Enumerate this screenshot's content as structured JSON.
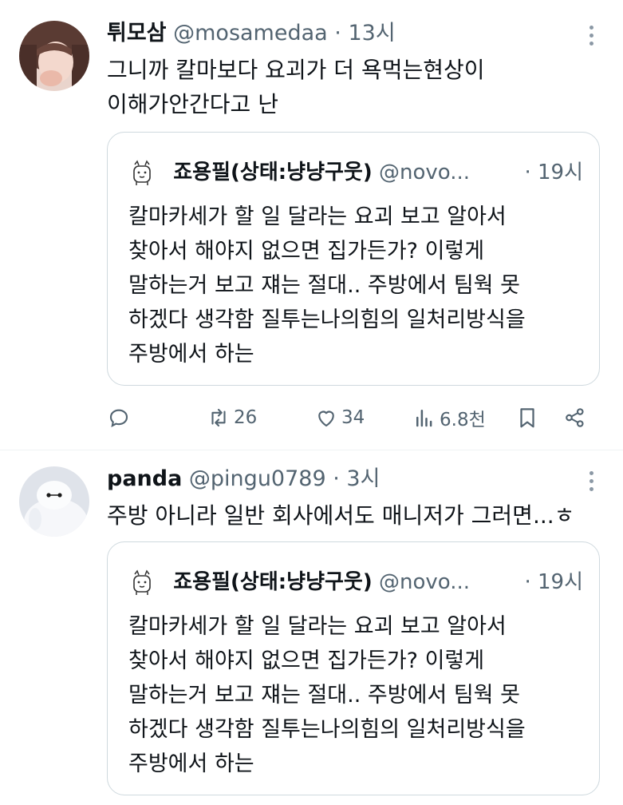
{
  "tweets": [
    {
      "name": "튀모삼",
      "handle": "@mosamedaa",
      "dot": "·",
      "time": "13시",
      "text": "그니까 칼마보다 요괴가 더 욕먹는현상이\n이해가안간다고 난",
      "quote": {
        "name": "죠용필(상태:냥냥구웃)",
        "handle": "@novo...",
        "time": "· 19시",
        "text": "칼마카세가 할 일 달라는 요괴 보고 알아서\n찾아서 해야지 없으면 집가든가? 이렇게\n말하는거 보고 쟤는 절대.. 주방에서 팀웍 못\n하겠다 생각함 질투는나의힘의 일처리방식을\n주방에서 하는"
      },
      "stats": {
        "retweets": "26",
        "likes": "34",
        "views": "6.8천"
      }
    },
    {
      "name": "panda",
      "handle": "@pingu0789",
      "dot": "·",
      "time": "3시",
      "text": "주방 아니라 일반 회사에서도 매니저가 그러면...ㅎ",
      "quote": {
        "name": "죠용필(상태:냥냥구웃)",
        "handle": "@novo...",
        "time": "· 19시",
        "text": "칼마카세가 할 일 달라는 요괴 보고 알아서\n찾아서 해야지 없으면 집가든가? 이렇게\n말하는거 보고 쟤는 절대.. 주방에서 팀웍 못\n하겠다 생각함 질투는나의힘의 일처리방식을\n주방에서 하는"
      }
    }
  ]
}
